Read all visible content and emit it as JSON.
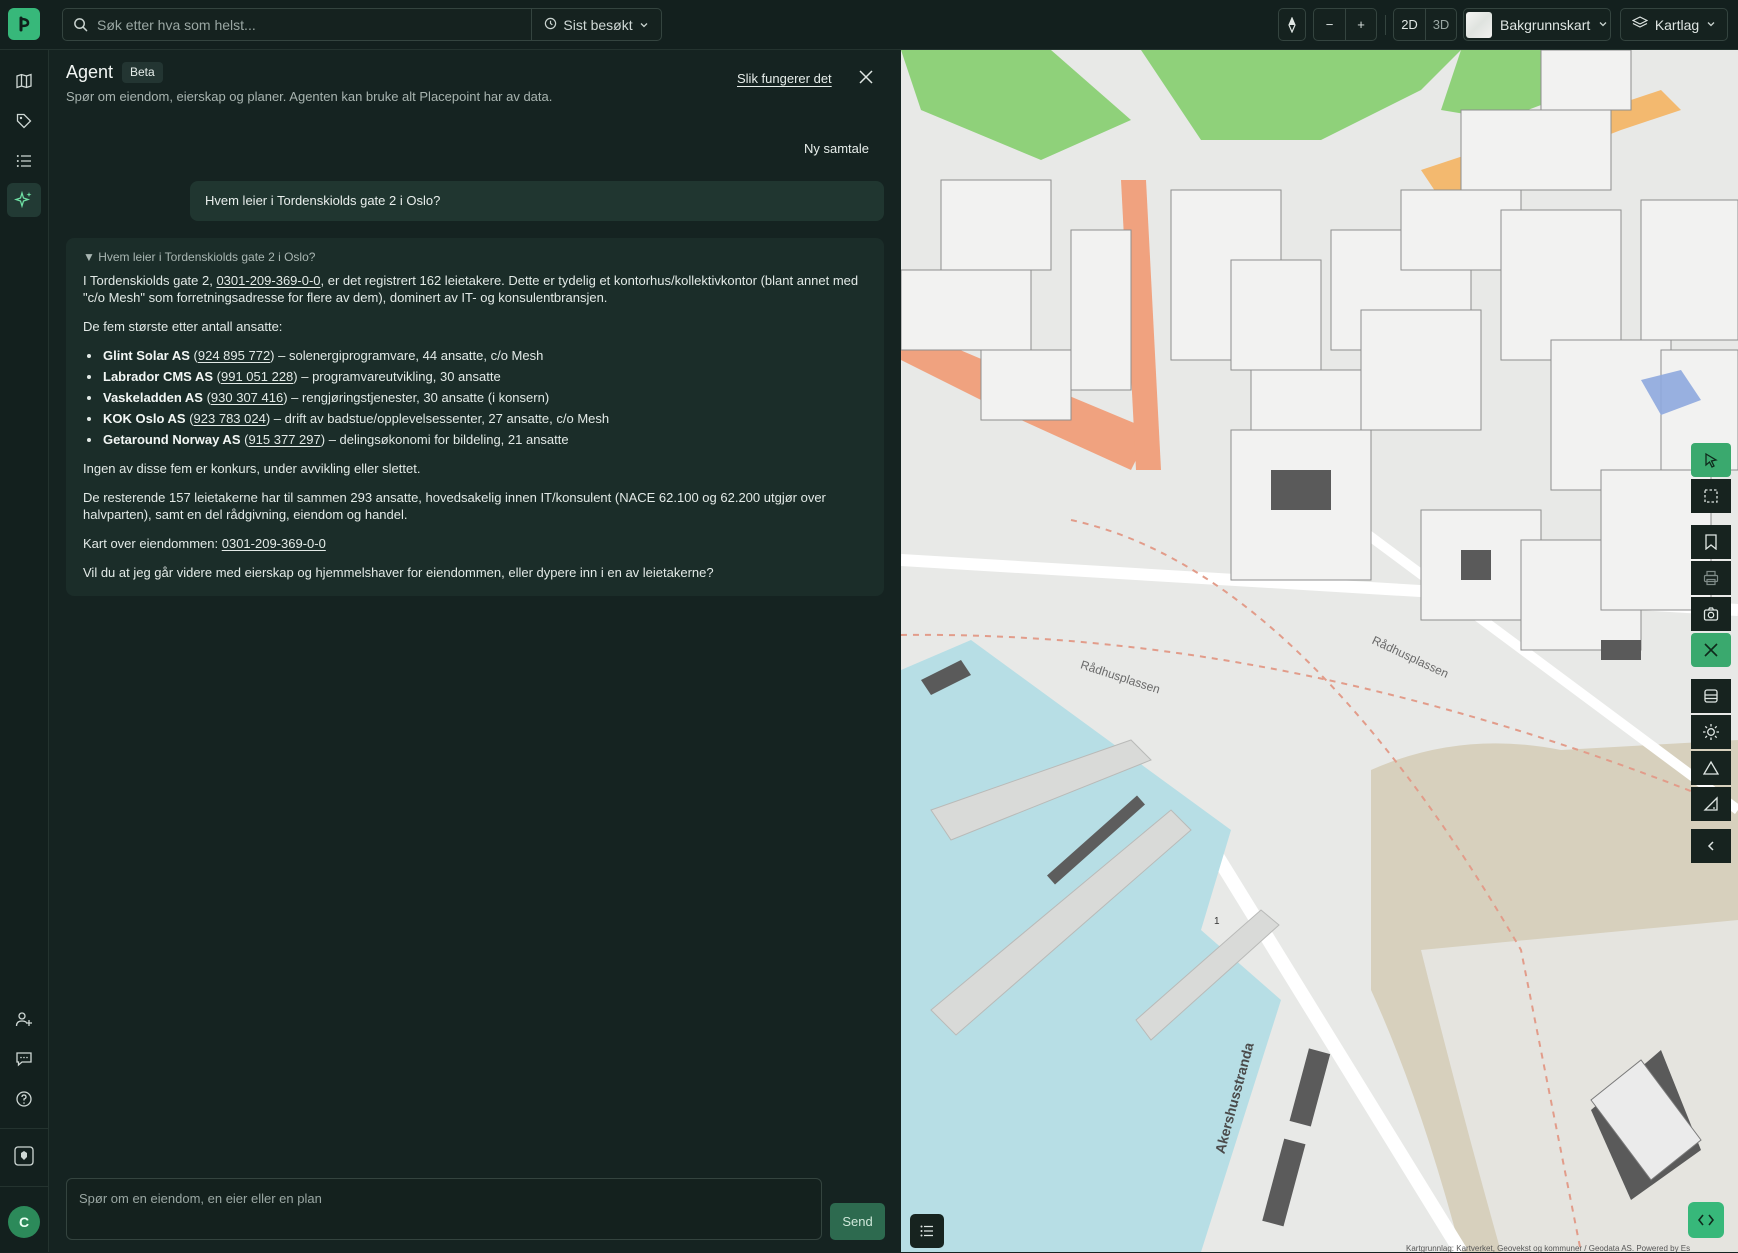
{
  "app": {
    "logo_letter": "p",
    "accent": "#37b87a"
  },
  "search": {
    "placeholder": "Søk etter hva som helst...",
    "recent_label": "Sist besøkt"
  },
  "toolbar": {
    "zoom_out": "−",
    "zoom_in": "+",
    "mode_2d": "2D",
    "mode_3d": "3D",
    "basemap_label": "Bakgrunnskart",
    "layers_label": "Kartlag"
  },
  "agent": {
    "title": "Agent",
    "badge": "Beta",
    "subtitle": "Spør om eiendom, eierskap og planer. Agenten kan bruke alt Placepoint har av data.",
    "howto_link": "Slik fungerer det",
    "new_chat": "Ny samtale",
    "user_question": "Hvem leier i Tordenskiolds gate 2 i Oslo?",
    "answer": {
      "summary": "▼ Hvem leier i Tordenskiolds gate 2 i Oslo?",
      "intro_pre": "I Tordenskiolds gate 2, ",
      "intro_link": "0301-209-369-0-0",
      "intro_post": ", er det registrert 162 leietakere. Dette er tydelig et kontorhus/kollektivkontor (blant annet med \"c/o Mesh\" som forretningsadresse for flere av dem), dominert av IT- og konsulentbransjen.",
      "top_heading": "De fem største etter antall ansatte:",
      "tenants": [
        {
          "name": "Glint Solar AS",
          "orgnr": "924 895 772",
          "desc": " – solenergiprogramvare, 44 ansatte, c/o Mesh"
        },
        {
          "name": "Labrador CMS AS",
          "orgnr": "991 051 228",
          "desc": " – programvareutvikling, 30 ansatte"
        },
        {
          "name": "Vaskeladden AS",
          "orgnr": "930 307 416",
          "desc": " – rengjøringstjenester, 30 ansatte (i konsern)"
        },
        {
          "name": "KOK Oslo AS",
          "orgnr": "923 783 024",
          "desc": " – drift av badstue/opplevelsessenter, 27 ansatte, c/o Mesh"
        },
        {
          "name": "Getaround Norway AS",
          "orgnr": "915 377 297",
          "desc": " – delingsøkonomi for bildeling, 21 ansatte"
        }
      ],
      "bankruptcy": "Ingen av disse fem er konkurs, under avvikling eller slettet.",
      "rest": "De resterende 157 leietakerne har til sammen 293 ansatte, hovedsakelig innen IT/konsulent (NACE 62.100 og 62.200 utgjør over halvparten), samt en del rådgivning, eiendom og handel.",
      "map_pre": "Kart over eiendommen: ",
      "map_link": "0301-209-369-0-0",
      "followup": "Vil du at jeg går videre med eierskap og hjemmelshaver for eiendommen, eller dypere inn i en av leietakerne?"
    },
    "composer_placeholder": "Spør om en eiendom, en eier eller en plan",
    "send_label": "Send"
  },
  "user": {
    "avatar_initial": "C"
  },
  "map": {
    "labels": {
      "square_left": "Rådhusplassen",
      "square_right": "Rådhusplassen",
      "street": "Akershusstranda",
      "pier_number": "1"
    },
    "attribution": "Kartgrunnlag: Kartverket, Geovekst og kommuner / Geodata AS. Powered by Es"
  }
}
